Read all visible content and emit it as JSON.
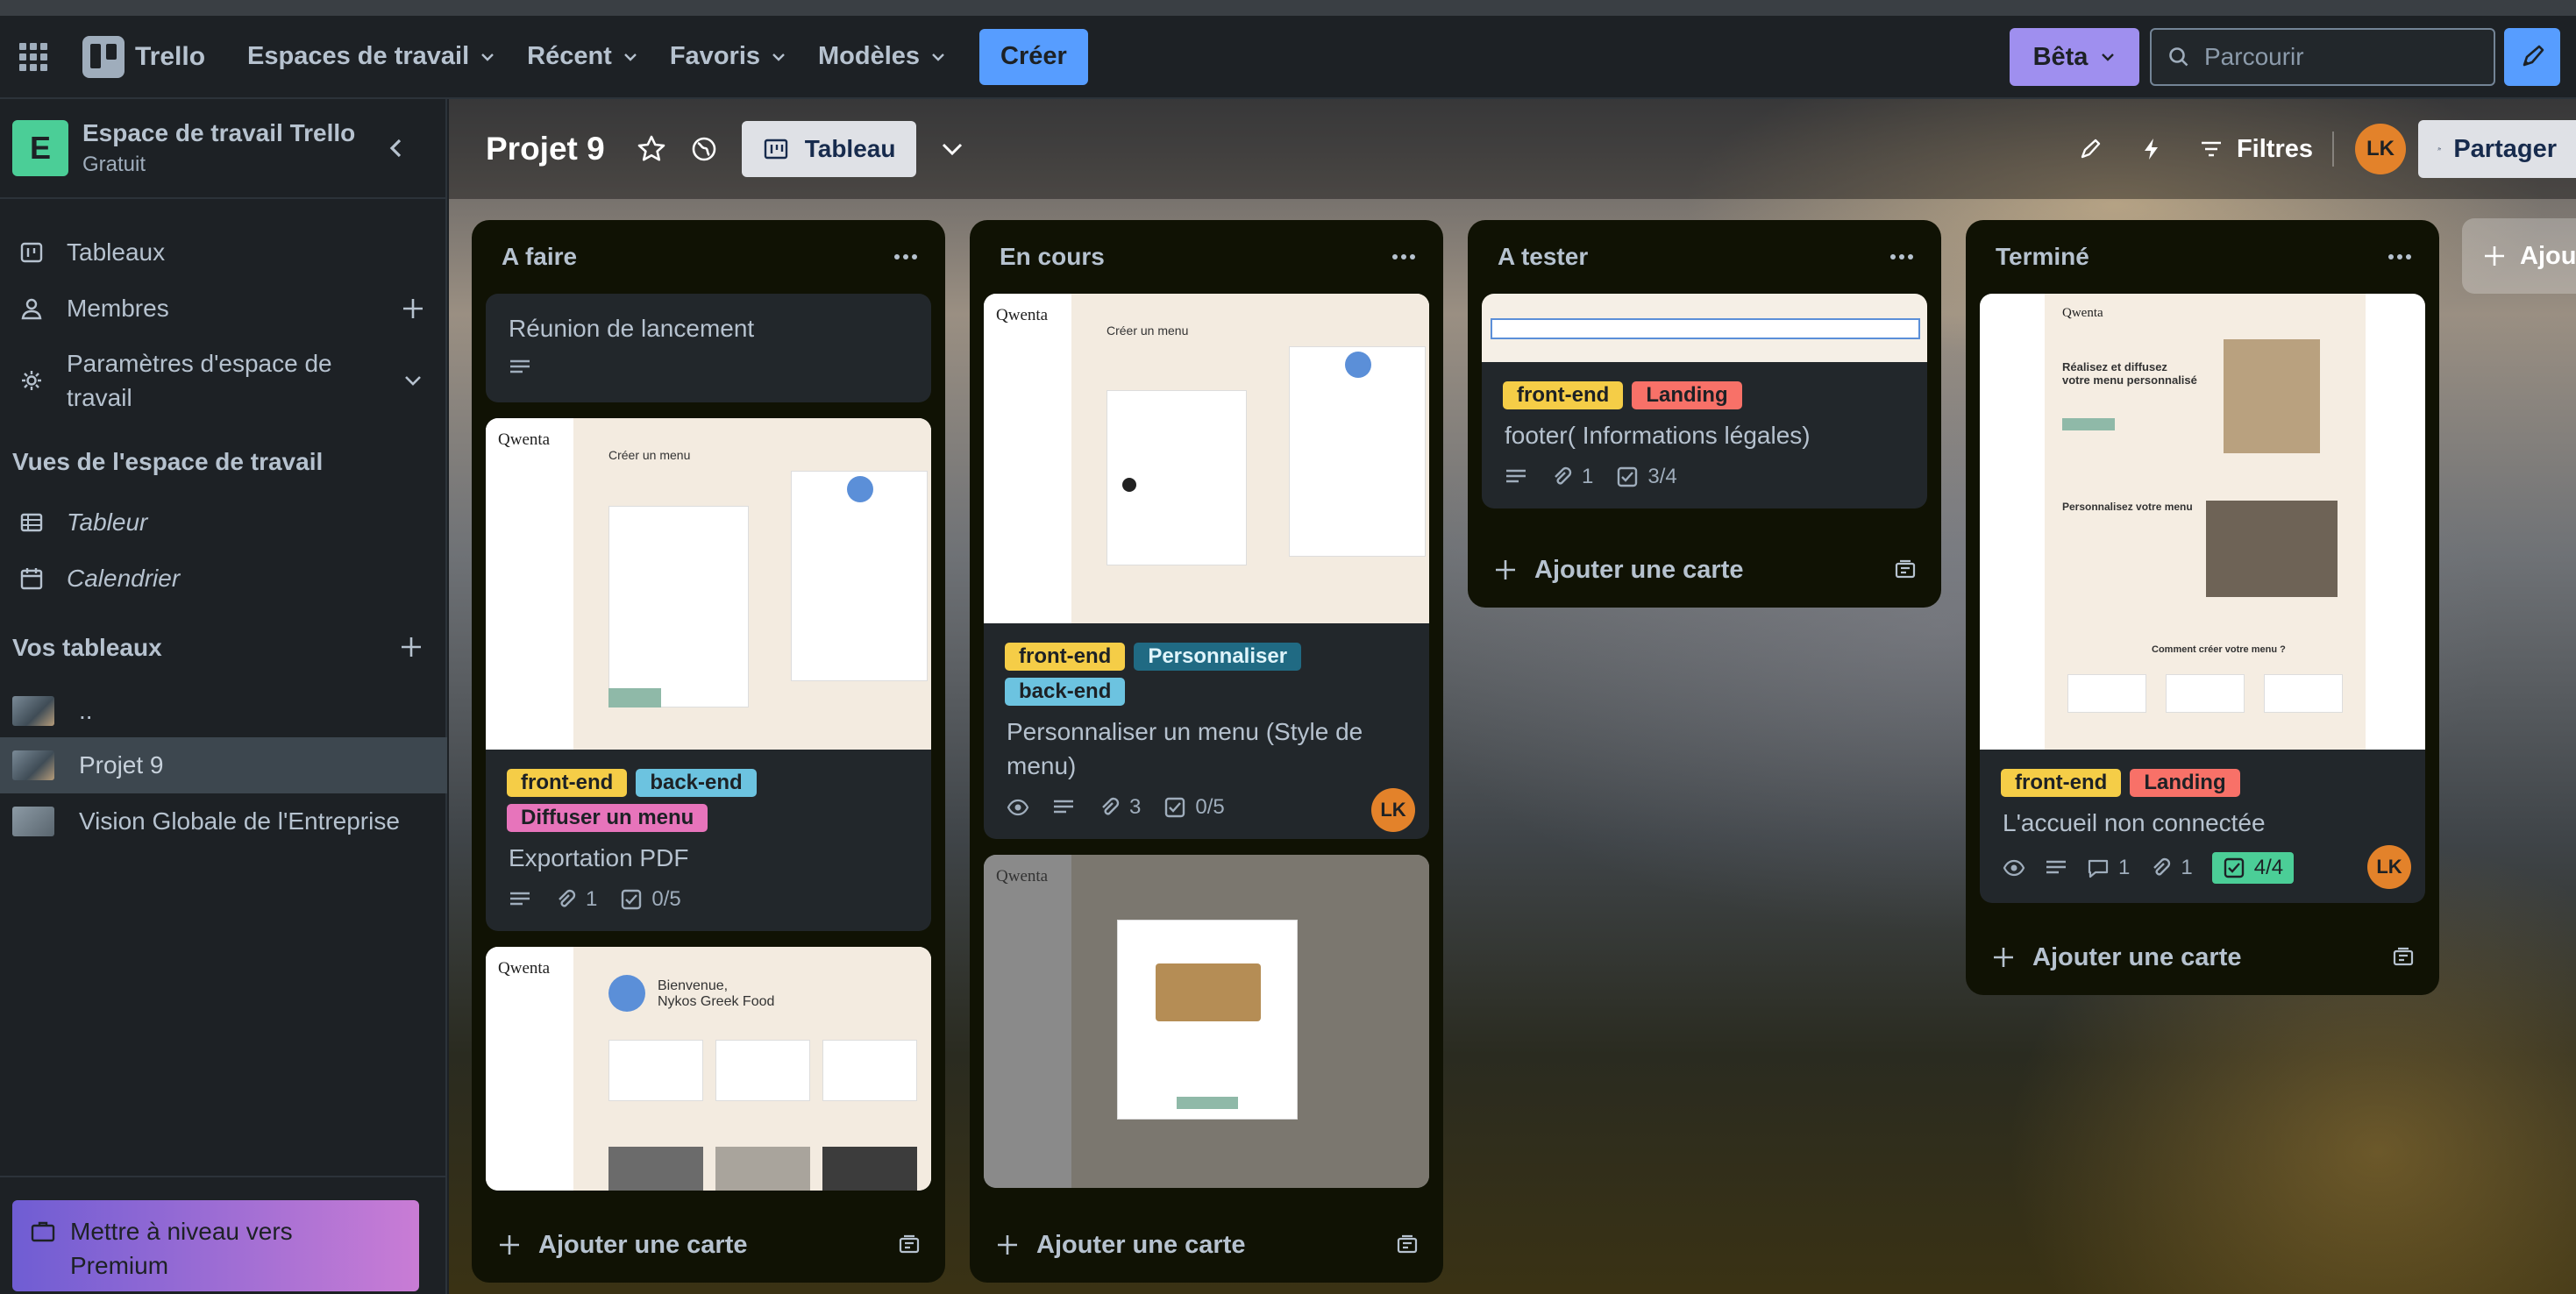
{
  "topbar": {
    "app_name": "Trello",
    "menus": [
      "Espaces de travail",
      "Récent",
      "Favoris",
      "Modèles"
    ],
    "create_label": "Créer",
    "beta_label": "Bêta",
    "search_placeholder": "Parcourir"
  },
  "workspace": {
    "avatar_letter": "E",
    "name": "Espace de travail Trello",
    "plan": "Gratuit"
  },
  "sidebar": {
    "items": [
      {
        "label": "Tableaux",
        "icon": "board-icon"
      },
      {
        "label": "Membres",
        "icon": "member-icon"
      },
      {
        "label": "Paramètres d'espace de travail",
        "icon": "gear-icon"
      }
    ],
    "views_heading": "Vues de l'espace de travail",
    "views": [
      {
        "label": "Tableur",
        "icon": "table-icon"
      },
      {
        "label": "Calendrier",
        "icon": "calendar-icon"
      }
    ],
    "boards_heading": "Vos tableaux",
    "boards": [
      "..",
      "Projet 9",
      "Vision Globale de l'Entreprise"
    ],
    "premium": "Mettre à niveau vers Premium"
  },
  "board": {
    "title": "Projet 9",
    "view_label": "Tableau",
    "filters_label": "Filtres",
    "avatar_initials": "LK",
    "share_label": "Partager",
    "add_list_label": "Ajouter"
  },
  "colors": {
    "yellow": "#f5cd47",
    "red": "#f87168",
    "teal": "#6cc3e0",
    "pink": "#e774bb",
    "green": "#4bce97",
    "blue": "#579dff"
  },
  "lists": [
    {
      "title": "A faire",
      "add_card": "Ajouter une carte",
      "cards": [
        {
          "title": "Réunion de lancement"
        },
        {
          "labels": [
            "front-end",
            "back-end",
            "Diffuser un menu"
          ],
          "title": "Exportation PDF",
          "attachments": "1",
          "checklist": "0/5"
        },
        {
          "title": ""
        }
      ]
    },
    {
      "title": "En cours",
      "add_card": "Ajouter une carte",
      "cards": [
        {
          "labels": [
            "front-end",
            "Personnaliser",
            "back-end"
          ],
          "title": "Personnaliser un menu (Style de menu)",
          "attachments": "3",
          "checklist": "0/5",
          "member": "LK"
        },
        {
          "title": ""
        }
      ]
    },
    {
      "title": "A tester",
      "add_card": "Ajouter une carte",
      "cards": [
        {
          "labels": [
            "front-end",
            "Landing"
          ],
          "title": "footer( Informations légales)",
          "attachments": "1",
          "checklist": "3/4"
        }
      ]
    },
    {
      "title": "Terminé",
      "add_card": "Ajouter une carte",
      "cards": [
        {
          "labels": [
            "front-end",
            "Landing"
          ],
          "title": "L'accueil non connectée",
          "comments": "1",
          "attachments": "1",
          "checklist": "4/4",
          "member": "LK"
        }
      ]
    }
  ]
}
